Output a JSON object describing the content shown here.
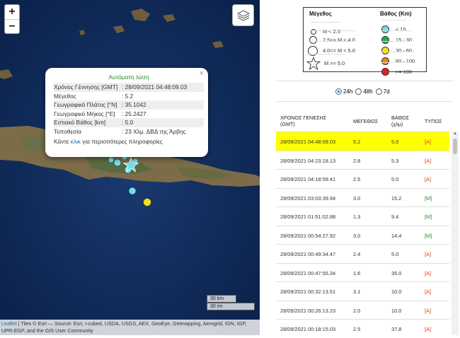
{
  "map": {
    "zoom_in": "+",
    "zoom_out": "−",
    "scale_km": "30 km",
    "scale_mi": "30 mi",
    "attribution_link": "Leaflet",
    "attribution_text": " | Tiles © Esri — Source: Esri, i-cubed, USDA, USGS, AEX, GeoEye, Getmapping, Aerogrid, IGN, IGP, UPR-EGP, and the GIS User Community"
  },
  "popup": {
    "close": "×",
    "title": "Αυτόματη λύση",
    "rows": [
      {
        "k": "Χρόνος Γέννησης [GMT]",
        "v": ": 28/09/2021 04:48:09.03"
      },
      {
        "k": "Μέγεθος",
        "v": ": 5.2"
      },
      {
        "k": "Γεωγραφικό Πλάτος [°N]",
        "v": ": 35.1042"
      },
      {
        "k": "Γεωγραφικό Μήκος [°E]",
        "v": ": 25.2427"
      },
      {
        "k": "Εστιακό Βάθος [km]",
        "v": ": 5.0"
      },
      {
        "k": "Τοποθεσία",
        "v": ": 23 Χλμ. ΔΒΔ της Άρβης"
      }
    ],
    "more_pre": "Κάντε ",
    "more_link": "κλικ",
    "more_post": " για περισσότερες πληροφορίες"
  },
  "legend": {
    "mag_title": "Μέγεθος",
    "mag_items": [
      "M < 2.5",
      "2.5<= M < 4.0",
      "4.0<= M < 5.0",
      "M >= 5.0"
    ],
    "depth_title": "Βάθος (Km)",
    "depth_items": [
      {
        "label": "< 15",
        "color": "#6fe0e8"
      },
      {
        "label": "15 - 30",
        "color": "#2aa84a"
      },
      {
        "label": "30 - 60",
        "color": "#f0e020"
      },
      {
        "label": "60 - 100",
        "color": "#f08020"
      },
      {
        "label": ">= 100",
        "color": "#e02020"
      }
    ]
  },
  "periods": {
    "p24": "24h",
    "p48": "48h",
    "p7": "7d",
    "selected": "24h"
  },
  "table": {
    "headers": {
      "time1": "ΧΡΟΝΟΣ ΓΕΝΕΣΗΣ",
      "time2": "(GMT)",
      "mag": "ΜΕΓΕΘΟΣ",
      "depth1": "ΒΑΘΟΣ",
      "depth2": "(χλμ)",
      "type": "ΤΥΠΟΣ"
    },
    "rows": [
      {
        "time": "28/09/2021 04:48:09.03",
        "mag": "5.2",
        "depth": "5.0",
        "type": "[A]"
      },
      {
        "time": "28/09/2021 04:23:18.13",
        "mag": "2.8",
        "depth": "5.3",
        "type": "[A]"
      },
      {
        "time": "28/09/2021 04:18:59.41",
        "mag": "2.5",
        "depth": "5.0",
        "type": "[A]"
      },
      {
        "time": "28/09/2021 03:03:39.94",
        "mag": "3.0",
        "depth": "15.2",
        "type": "[M]"
      },
      {
        "time": "28/09/2021 01:51:02.88",
        "mag": "1.3",
        "depth": "9.4",
        "type": "[M]"
      },
      {
        "time": "28/09/2021 00:54:27.92",
        "mag": "3.0",
        "depth": "14.4",
        "type": "[M]"
      },
      {
        "time": "28/09/2021 00:49:34.47",
        "mag": "2.4",
        "depth": "5.0",
        "type": "[A]"
      },
      {
        "time": "28/09/2021 00:47:55.34",
        "mag": "1.6",
        "depth": "35.0",
        "type": "[A]"
      },
      {
        "time": "28/09/2021 00:32:13.51",
        "mag": "3.1",
        "depth": "10.0",
        "type": "[A]"
      },
      {
        "time": "28/09/2021 00:26:13.23",
        "mag": "2.0",
        "depth": "10.0",
        "type": "[A]"
      },
      {
        "time": "28/09/2021 00:18:15.03",
        "mag": "2.5",
        "depth": "37.8",
        "type": "[A]"
      }
    ]
  }
}
